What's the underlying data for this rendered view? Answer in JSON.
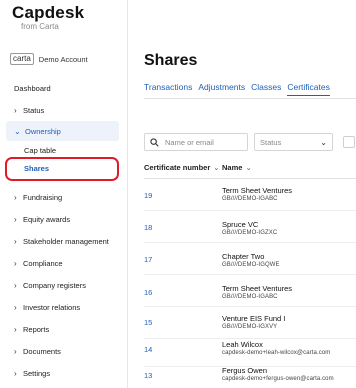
{
  "brand": {
    "name": "Capdesk",
    "tagline": "from Carta"
  },
  "account": {
    "logo_text": "carta",
    "name": "Demo Account"
  },
  "sidebar": {
    "dashboard": "Dashboard",
    "items": [
      {
        "label": "Status"
      },
      {
        "label": "Ownership"
      },
      {
        "label": "Fundraising"
      },
      {
        "label": "Equity awards"
      },
      {
        "label": "Stakeholder management"
      },
      {
        "label": "Compliance"
      },
      {
        "label": "Company registers"
      },
      {
        "label": "Investor relations"
      },
      {
        "label": "Reports"
      },
      {
        "label": "Documents"
      },
      {
        "label": "Settings"
      }
    ],
    "ownership_sub": [
      {
        "label": "Cap table"
      },
      {
        "label": "Shares"
      }
    ],
    "chevron_right": "›",
    "chevron_down": "⌄"
  },
  "page": {
    "title": "Shares"
  },
  "tabs": [
    {
      "label": "Transactions"
    },
    {
      "label": "Adjustments"
    },
    {
      "label": "Classes"
    },
    {
      "label": "Certificates"
    }
  ],
  "filters": {
    "search_placeholder": "Name or email",
    "status_placeholder": "Status",
    "chevron_down": "⌄"
  },
  "table": {
    "columns": [
      {
        "label": "Certificate number",
        "sort": "⌄"
      },
      {
        "label": "Name",
        "sort": "⌄"
      }
    ],
    "rows": [
      {
        "number": "19",
        "name": "Term Sheet Ventures",
        "detail": "GB////DEMO-IGABC"
      },
      {
        "number": "18",
        "name": "Spruce VC",
        "detail": "GB////DEMO-IGZXC"
      },
      {
        "number": "17",
        "name": "Chapter Two",
        "detail": "GB////DEMO-IGQWE"
      },
      {
        "number": "16",
        "name": "Term Sheet Ventures",
        "detail": "GB////DEMO-IGABC"
      },
      {
        "number": "15",
        "name": "Venture EIS Fund I",
        "detail": "GB////DEMO-IGXVY"
      },
      {
        "number": "14",
        "name": "Leah Wilcox",
        "detail": "capdesk-demo+leah-wilcox@carta.com"
      },
      {
        "number": "13",
        "name": "Fergus Owen",
        "detail": "capdesk-demo+fergus-owen@carta.com"
      }
    ]
  },
  "colors": {
    "accent": "#1f5fb8",
    "highlight_ring": "#e01c2a",
    "active_bg": "#eef2fb"
  }
}
